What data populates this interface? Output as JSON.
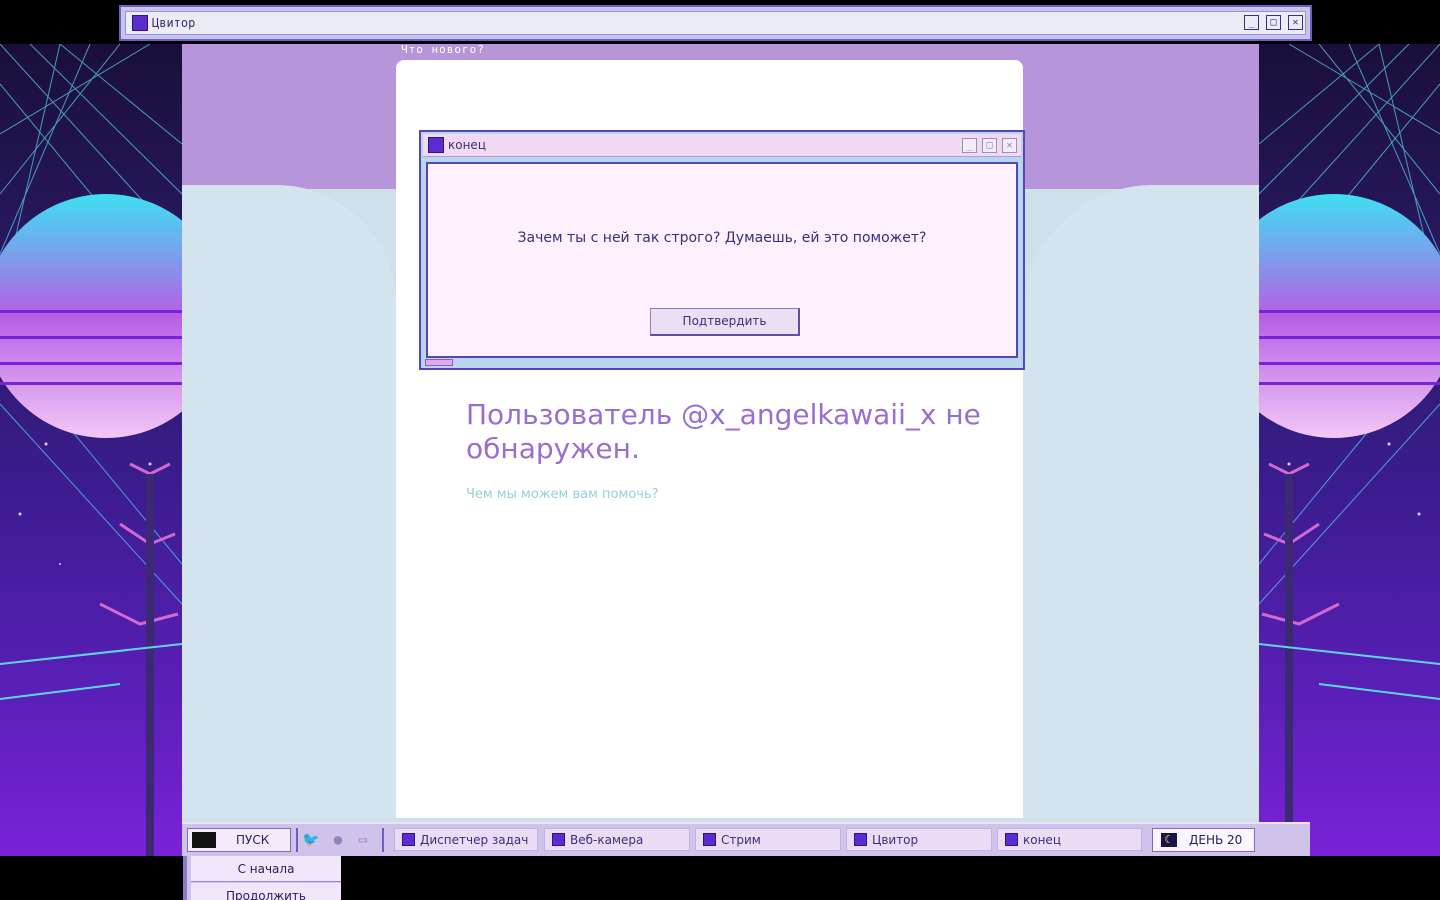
{
  "window": {
    "title": "Цвитор",
    "controls": {
      "minimize": "_",
      "maximize": "□",
      "close": "✕"
    }
  },
  "page": {
    "whats_new": "Что нового?",
    "not_found_title": "Пользователь @x_angelkawaii_x не обнаружен.",
    "help_link": "Чем мы можем вам помочь?"
  },
  "dialog": {
    "title": "конец",
    "message": "Зачем ты с ней так строго? Думаешь, ей это поможет?",
    "confirm_label": "Подтвердить",
    "controls": {
      "minimize": "_",
      "maximize": "□",
      "close": "✕"
    }
  },
  "taskbar": {
    "start_label": "ПУСК",
    "tray_icons": [
      "bird-icon",
      "chat-icon",
      "monitor-icon"
    ],
    "tasks": [
      {
        "label": "Диспетчер задач"
      },
      {
        "label": "Веб-камера"
      },
      {
        "label": "Стрим"
      },
      {
        "label": "Цвитор"
      },
      {
        "label": "конец"
      }
    ],
    "day_label": "ДЕНЬ 20"
  },
  "start_menu": {
    "items": [
      {
        "label": "С начала"
      },
      {
        "label": "Продолжить"
      }
    ]
  },
  "colors": {
    "accent": "#5b2dd1",
    "title_purple": "#9a6dd0",
    "link_cyan": "#93cfe0",
    "window_border": "#5546b3"
  }
}
